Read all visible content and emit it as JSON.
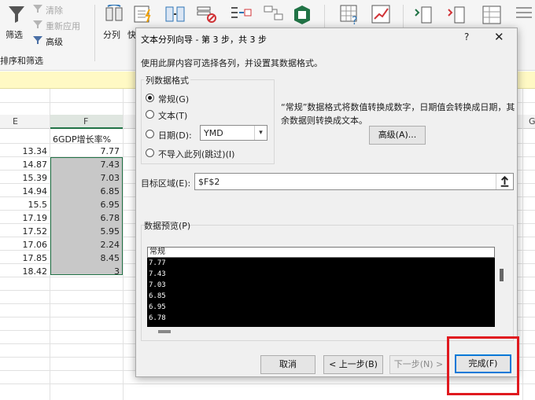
{
  "ribbon": {
    "filter_label": "筛选",
    "clear_label": "清除",
    "reapply_label": "重新应用",
    "advanced_label": "高级",
    "group_label": "排序和筛选",
    "split_label": "分列",
    "quick_label": "快"
  },
  "sheet": {
    "col_e": "E",
    "col_f": "F",
    "col_g": "G",
    "f_header": "6GDP增长率%",
    "e_values": [
      "13.34",
      "14.87",
      "15.39",
      "14.94",
      "15.5",
      "17.19",
      "17.52",
      "17.06",
      "17.85",
      "18.42"
    ],
    "f_values": [
      "7.77",
      "7.43",
      "7.03",
      "6.85",
      "6.95",
      "6.78",
      "5.95",
      "2.24",
      "8.45",
      "3"
    ]
  },
  "dialog": {
    "title": "文本分列向导 - 第 3 步，共 3 步",
    "help": "?",
    "close": "✕",
    "description": "使用此屏内容可选择各列，并设置其数据格式。",
    "format_group_label": "列数据格式",
    "radio_general": "常规(G)",
    "radio_text": "文本(T)",
    "radio_date": "日期(D):",
    "radio_skip": "不导入此列(跳过)(I)",
    "date_format": "YMD",
    "note": "“常规”数据格式将数值转换成数字，日期值会转换成日期，其余数据则转换成文本。",
    "advanced_button": "高级(A)...",
    "target_label": "目标区域(E):",
    "target_value": "$F$2",
    "preview_label": "数据预览(P)",
    "preview_header": "常规",
    "preview_rows": [
      "7.77",
      "7.43",
      "7.03",
      "6.85",
      "6.95",
      "6.78"
    ],
    "cancel_button": "取消",
    "back_button": "< 上一步(B)",
    "next_button": "下一步(N) >",
    "finish_button": "完成(F)"
  },
  "colors": {
    "excel_green": "#217346",
    "highlight_red": "#e0191f",
    "selection_gray": "#c8c8c8"
  }
}
